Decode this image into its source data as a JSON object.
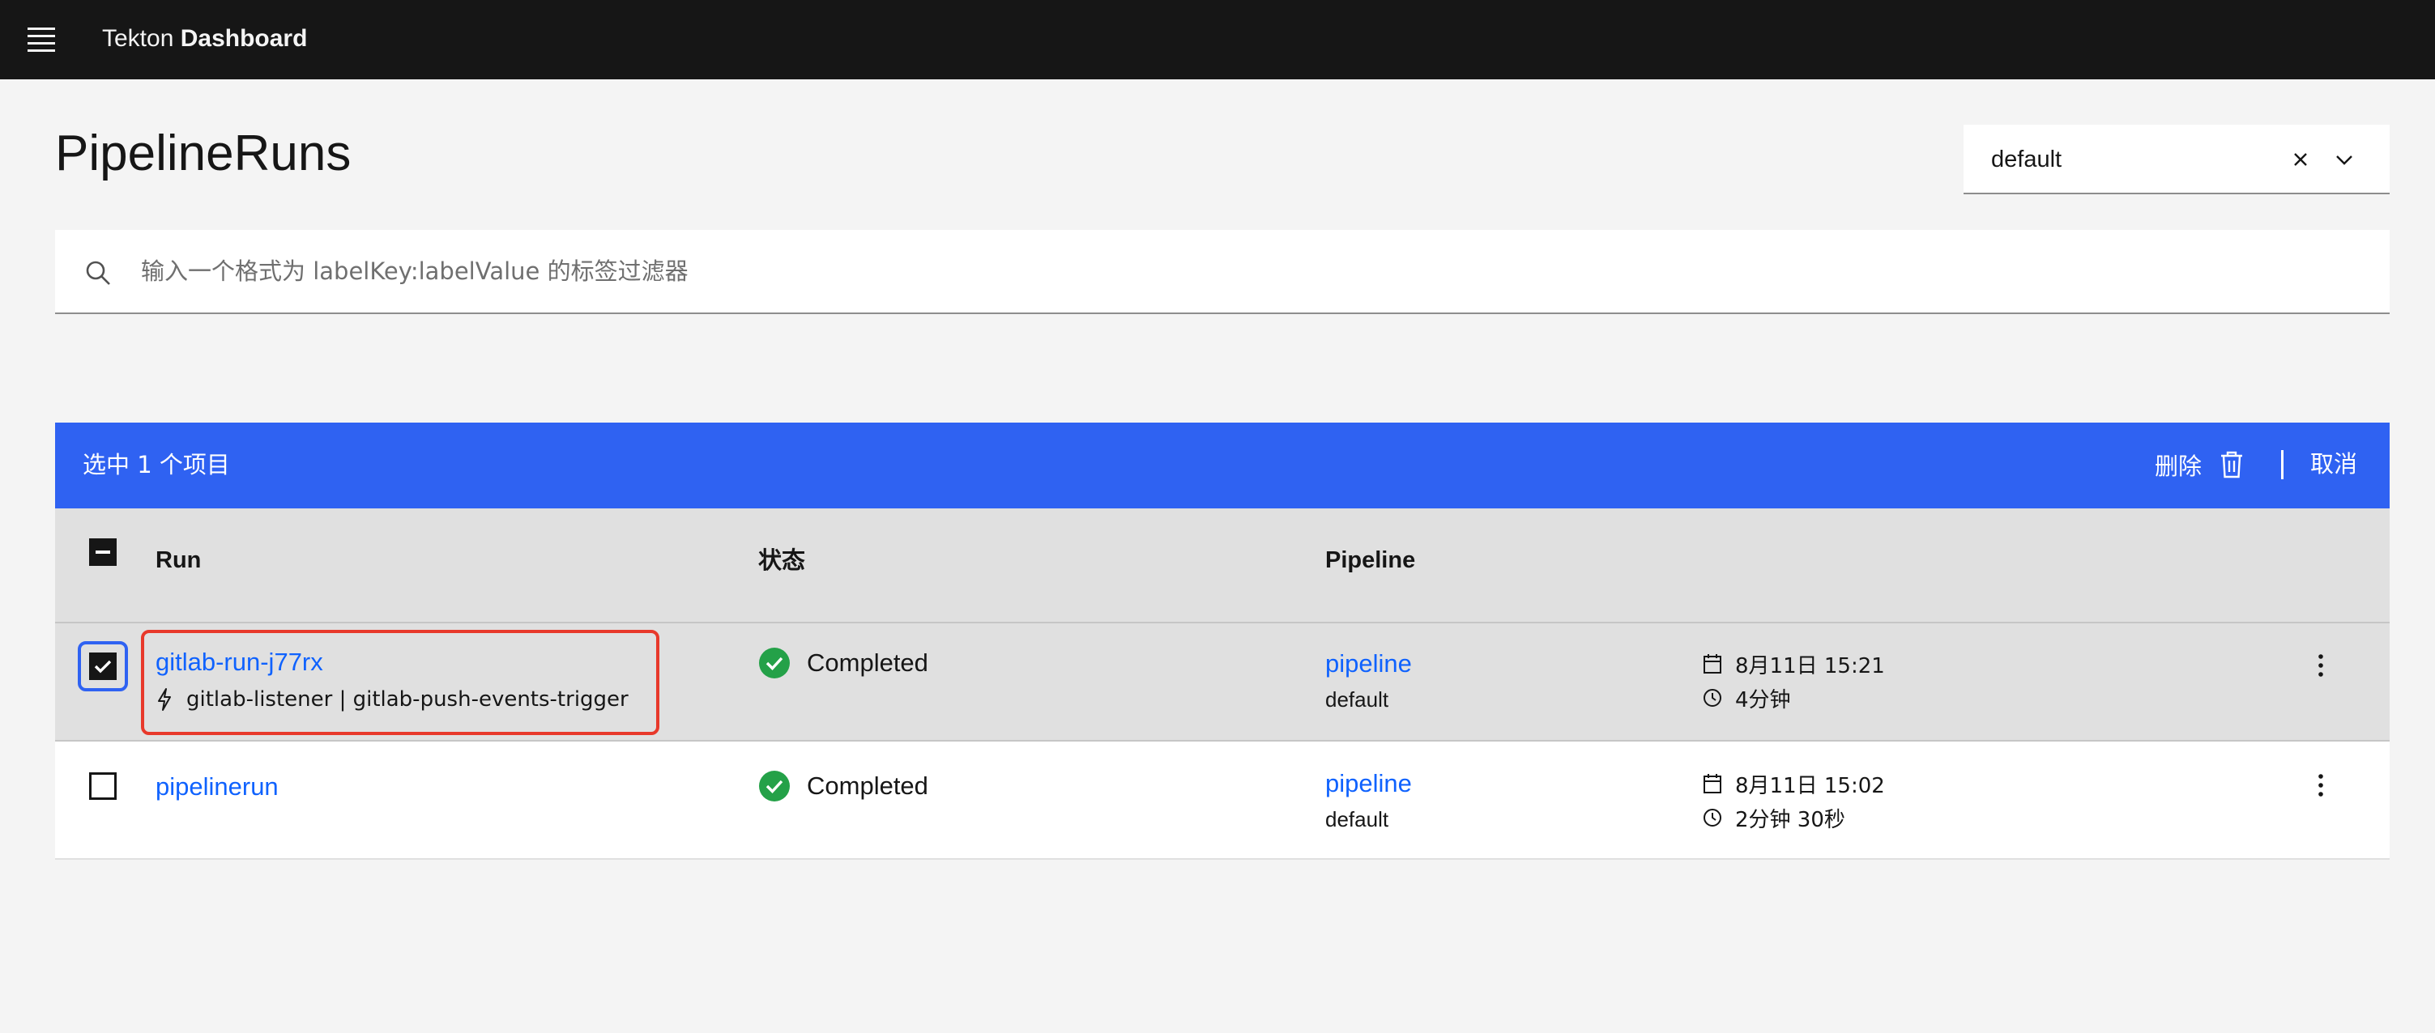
{
  "header": {
    "brand_prefix": "Tekton",
    "brand_name": "Dashboard"
  },
  "page": {
    "title": "PipelineRuns"
  },
  "namespace_select": {
    "value": "default"
  },
  "search": {
    "placeholder": "输入一个格式为 labelKey:labelValue 的标签过滤器",
    "value": ""
  },
  "batch_actions": {
    "selected_text": "选中 1 个项目",
    "delete_label": "删除",
    "cancel_label": "取消"
  },
  "table": {
    "headers": {
      "run": "Run",
      "status": "状态",
      "pipeline": "Pipeline"
    },
    "rows": [
      {
        "run": "gitlab-run-j77rx",
        "trigger": "gitlab-listener | gitlab-push-events-trigger",
        "status": "Completed",
        "pipeline": "pipeline",
        "namespace": "default",
        "created": "8月11日 15:21",
        "duration": "4分钟",
        "selected": true
      },
      {
        "run": "pipelinerun",
        "status": "Completed",
        "pipeline": "pipeline",
        "namespace": "default",
        "created": "8月11日 15:02",
        "duration": "2分钟 30秒",
        "selected": false
      }
    ]
  },
  "colors": {
    "header_bg": "#161616",
    "page_bg": "#f4f4f4",
    "batch_bar": "#2f62f2",
    "link": "#0f62fe",
    "success": "#24a148",
    "highlight_box": "#e8392b"
  },
  "icons": {
    "menu": "hamburger-menu-icon",
    "clear": "close-icon",
    "caret": "chevron-down-icon",
    "search": "search-icon",
    "delete": "trash-icon",
    "trigger": "lightning-bolt-icon",
    "status": "checkmark-filled-icon",
    "created": "calendar-icon",
    "duration": "clock-icon",
    "overflow": "overflow-menu-vertical-icon"
  }
}
